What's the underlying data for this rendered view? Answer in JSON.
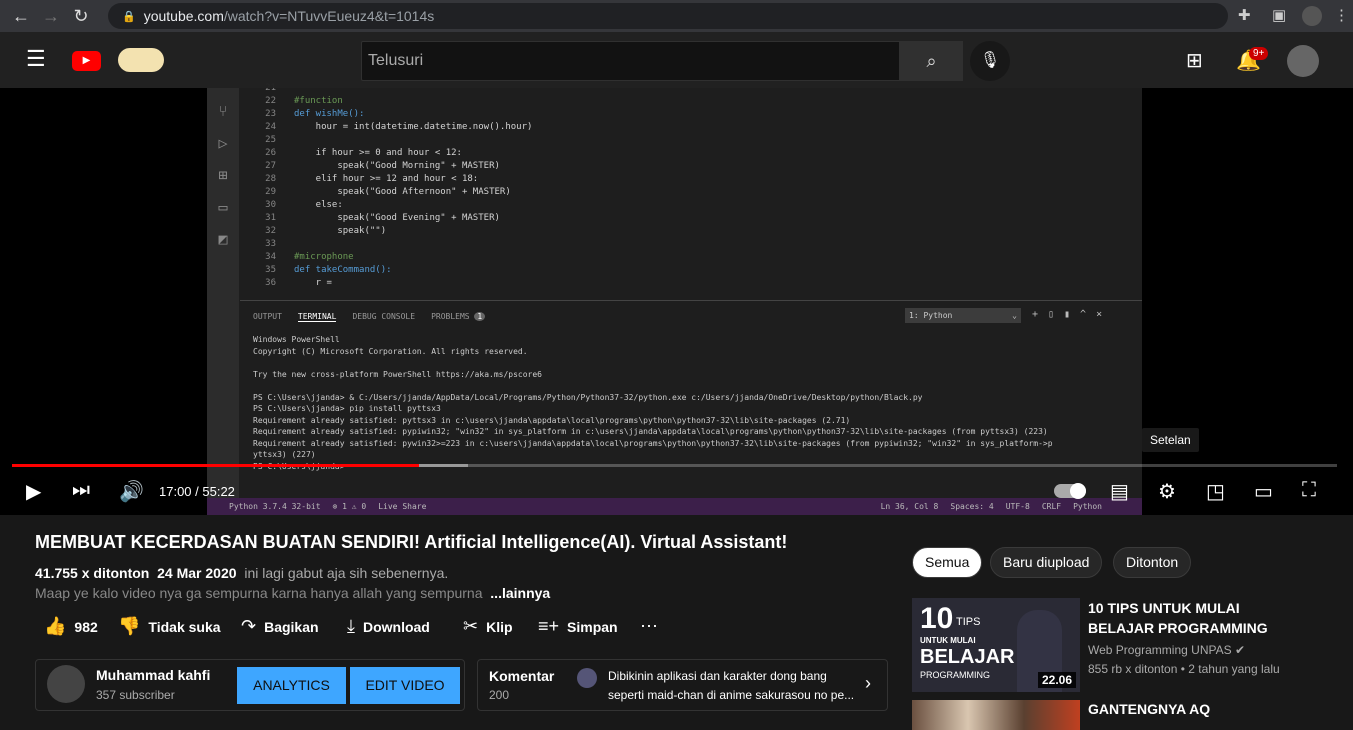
{
  "browser": {
    "url_domain": "youtube.com",
    "url_path": "/watch?v=NTuvvEueuz4&t=1014s"
  },
  "header": {
    "search_placeholder": "Telusuri",
    "notif_count": "9+"
  },
  "video": {
    "code_lines": [
      {
        "n": "21",
        "t": ""
      },
      {
        "n": "22",
        "t": "#function"
      },
      {
        "n": "23",
        "t": "def wishMe():"
      },
      {
        "n": "24",
        "t": "    hour = int(datetime.datetime.now().hour)"
      },
      {
        "n": "25",
        "t": ""
      },
      {
        "n": "26",
        "t": "    if hour >= 0 and hour < 12:"
      },
      {
        "n": "27",
        "t": "        speak(\"Good Morning\" + MASTER)"
      },
      {
        "n": "28",
        "t": "    elif hour >= 12 and hour < 18:"
      },
      {
        "n": "29",
        "t": "        speak(\"Good Afternoon\" + MASTER)"
      },
      {
        "n": "30",
        "t": "    else:"
      },
      {
        "n": "31",
        "t": "        speak(\"Good Evening\" + MASTER)"
      },
      {
        "n": "32",
        "t": "        speak(\"\")"
      },
      {
        "n": "33",
        "t": ""
      },
      {
        "n": "34",
        "t": "#microphone"
      },
      {
        "n": "35",
        "t": "def takeCommand():"
      },
      {
        "n": "36",
        "t": "    r ="
      }
    ],
    "panel_tabs": [
      "OUTPUT",
      "TERMINAL",
      "DEBUG CONSOLE",
      "PROBLEMS"
    ],
    "problems_count": "1",
    "terminal_select": "1: Python",
    "terminal_lines": [
      "Windows PowerShell",
      "Copyright (C) Microsoft Corporation. All rights reserved.",
      "",
      "Try the new cross-platform PowerShell https://aka.ms/pscore6",
      "",
      "PS C:\\Users\\jjanda> & C:/Users/jjanda/AppData/Local/Programs/Python/Python37-32/python.exe c:/Users/jjanda/OneDrive/Desktop/python/Black.py",
      "PS C:\\Users\\jjanda> pip install pyttsx3",
      "Requirement already satisfied: pyttsx3 in c:\\users\\jjanda\\appdata\\local\\programs\\python\\python37-32\\lib\\site-packages (2.71)",
      "Requirement already satisfied: pypiwin32; \"win32\" in sys_platform in c:\\users\\jjanda\\appdata\\local\\programs\\python\\python37-32\\lib\\site-packages (from pyttsx3) (223)",
      "Requirement already satisfied: pywin32>=223 in c:\\users\\jjanda\\appdata\\local\\programs\\python\\python37-32\\lib\\site-packages (from pypiwin32; \"win32\" in sys_platform->p",
      "yttsx3) (227)",
      "PS C:\\Users\\jjanda> "
    ],
    "status_left": [
      "Python 3.7.4 32-bit",
      "⊗ 1 ⚠ 0",
      "Live Share"
    ],
    "status_right": [
      "Ln 36, Col 8",
      "Spaces: 4",
      "UTF-8",
      "CRLF",
      "Python"
    ]
  },
  "player": {
    "time": "17:00 / 55:22",
    "progress": 0.307,
    "buffered": 0.344,
    "tooltip": "Setelan"
  },
  "info": {
    "title": "MEMBUAT KECERDASAN BUATAN SENDIRI! Artificial Intelligence(AI). Virtual Assistant!",
    "views": "41.755 x ditonton",
    "date": "24 Mar 2020",
    "desc1": "ini lagi gabut aja sih sebenernya.",
    "desc2": "Maap ye kalo video nya ga sempurna karna hanya allah yang sempurna",
    "more": "...lainnya",
    "likes": "982",
    "dislike": "Tidak suka",
    "share": "Bagikan",
    "download": "Download",
    "clip": "Klip",
    "save": "Simpan"
  },
  "channel": {
    "name": "Muhammad kahfi",
    "subs": "357 subscriber",
    "analytics": "ANALYTICS",
    "edit": "EDIT VIDEO"
  },
  "comments": {
    "label": "Komentar",
    "count": "200",
    "preview": "Dibikinin aplikasi dan karakter dong bang seperti maid-chan di anime sakurasou no pe..."
  },
  "sidebar": {
    "chips": [
      "Semua",
      "Baru diupload",
      "Ditonton"
    ],
    "videos": [
      {
        "title": "10 TIPS UNTUK MULAI BELAJAR PROGRAMMING",
        "channel": "Web Programming UNPAS",
        "meta": "855 rb x ditonton • 2 tahun yang lalu",
        "duration": "22.06",
        "thumb_text": [
          "10",
          "TIPS",
          "UNTUK MULAI",
          "BELAJAR",
          "PROGRAMMING"
        ]
      },
      {
        "title": "GANTENGNYA AQ"
      }
    ]
  }
}
